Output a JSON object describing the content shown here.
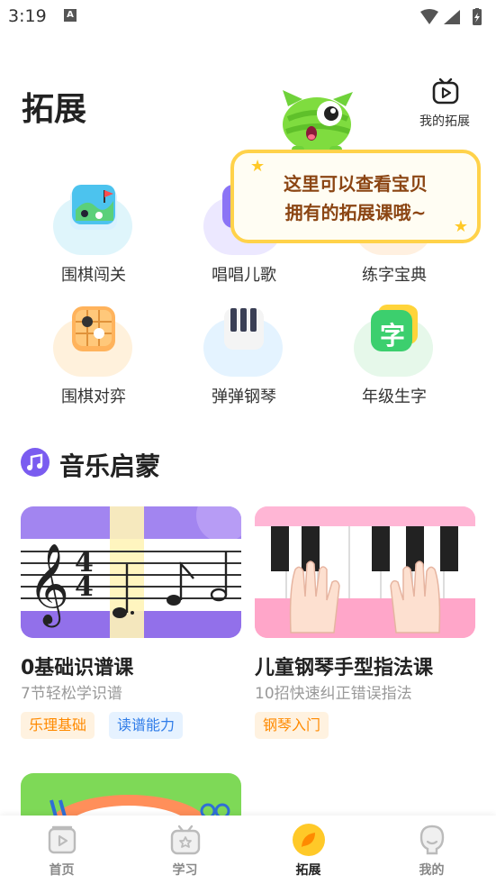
{
  "status_bar": {
    "time": "3:19",
    "notif_letter": "A"
  },
  "header": {
    "title": "拓展",
    "my_ext_label": "我的拓展"
  },
  "tooltip": {
    "line1": "这里可以查看宝贝",
    "line2": "拥有的拓展课哦~"
  },
  "tiles": [
    {
      "label": "围棋闯关",
      "icon": "go-map-icon"
    },
    {
      "label": "唱唱儿歌",
      "icon": "songs-icon"
    },
    {
      "label": "练字宝典",
      "icon": "handwriting-icon"
    },
    {
      "label": "围棋对弈",
      "icon": "go-board-icon"
    },
    {
      "label": "弹弹钢琴",
      "icon": "piano-keys-icon"
    },
    {
      "label": "年级生字",
      "icon": "character-icon",
      "glyph": "字"
    }
  ],
  "section": {
    "title": "音乐启蒙"
  },
  "courses": [
    {
      "title": "0基础识谱课",
      "subtitle": "7节轻松学识谱",
      "tags": [
        "乐理基础",
        "读谱能力"
      ]
    },
    {
      "title": "儿童钢琴手型指法课",
      "subtitle": "10招快速纠正错误指法",
      "tags": [
        "钢琴入门"
      ]
    }
  ],
  "bottom_nav": [
    {
      "label": "首页",
      "active": false
    },
    {
      "label": "学习",
      "active": false
    },
    {
      "label": "拓展",
      "active": true
    },
    {
      "label": "我的",
      "active": false
    }
  ],
  "colors": {
    "accent": "#ffc928",
    "purple": "#7a5cf0",
    "tag_orange": "#ff8a00",
    "tag_blue": "#2f7ce8"
  }
}
